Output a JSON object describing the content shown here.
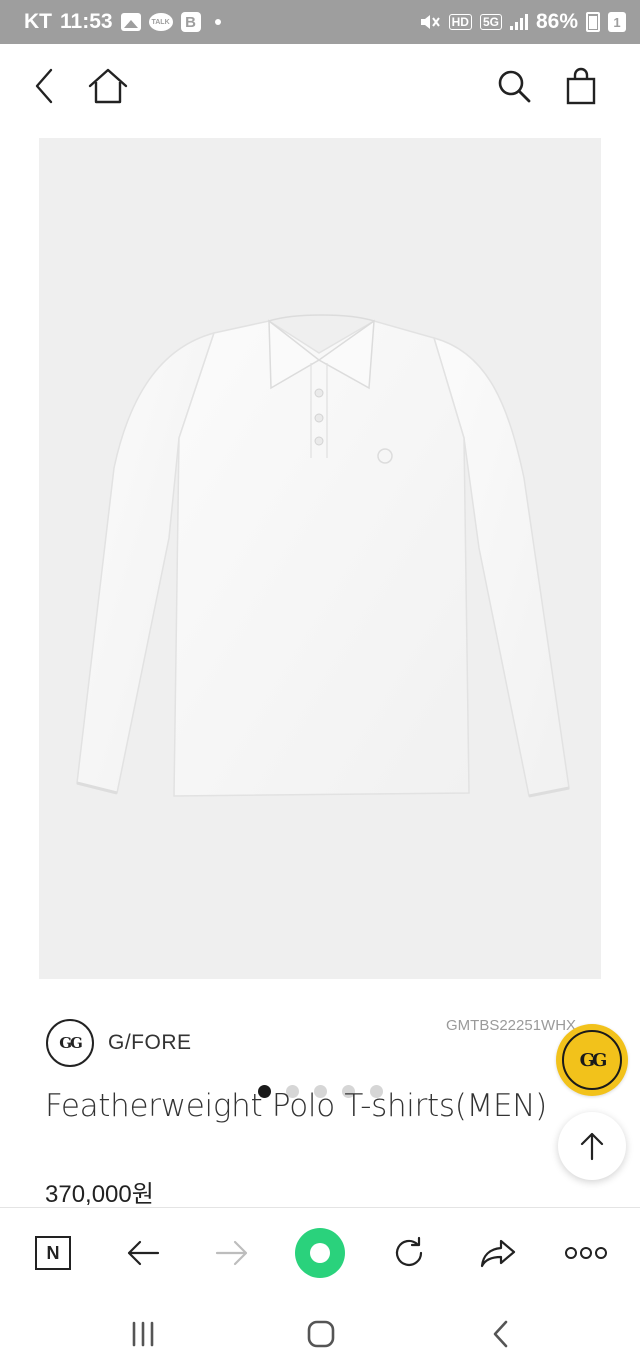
{
  "status_bar": {
    "carrier": "KT",
    "time": "11:53",
    "talk_label": "TALK",
    "b_label": "B",
    "hd_label": "HD",
    "network_label": "5G",
    "battery_percent": "86%",
    "notification_count": "1"
  },
  "product": {
    "image_dots_count": 5,
    "active_image_index": 0,
    "brand_name": "G/FORE",
    "brand_logo_text": "GG",
    "code": "GMTBS22251WHX",
    "title": "Featherweight Polo T-shirts(MEN)",
    "price": "370,000원"
  },
  "icons": {
    "back": "chevron-left-icon",
    "home": "home-icon",
    "search": "search-icon",
    "cart": "shopping-bag-icon",
    "scroll_top": "arrow-up-icon",
    "browser_n": "naver-n-icon",
    "browser_back": "arrow-left-icon",
    "browser_forward": "arrow-right-icon",
    "browser_green": "green-dot-icon",
    "refresh": "refresh-icon",
    "share": "share-icon",
    "more": "more-icon",
    "recent_apps": "recent-apps-icon",
    "android_home": "android-home-icon",
    "android_back": "android-back-icon"
  },
  "browser": {
    "n_label": "N"
  },
  "colors": {
    "status_bar_bg": "#9e9e9e",
    "image_bg": "#efefef",
    "badge_gold": "#f2c21b",
    "browser_green": "#2ad27c"
  }
}
